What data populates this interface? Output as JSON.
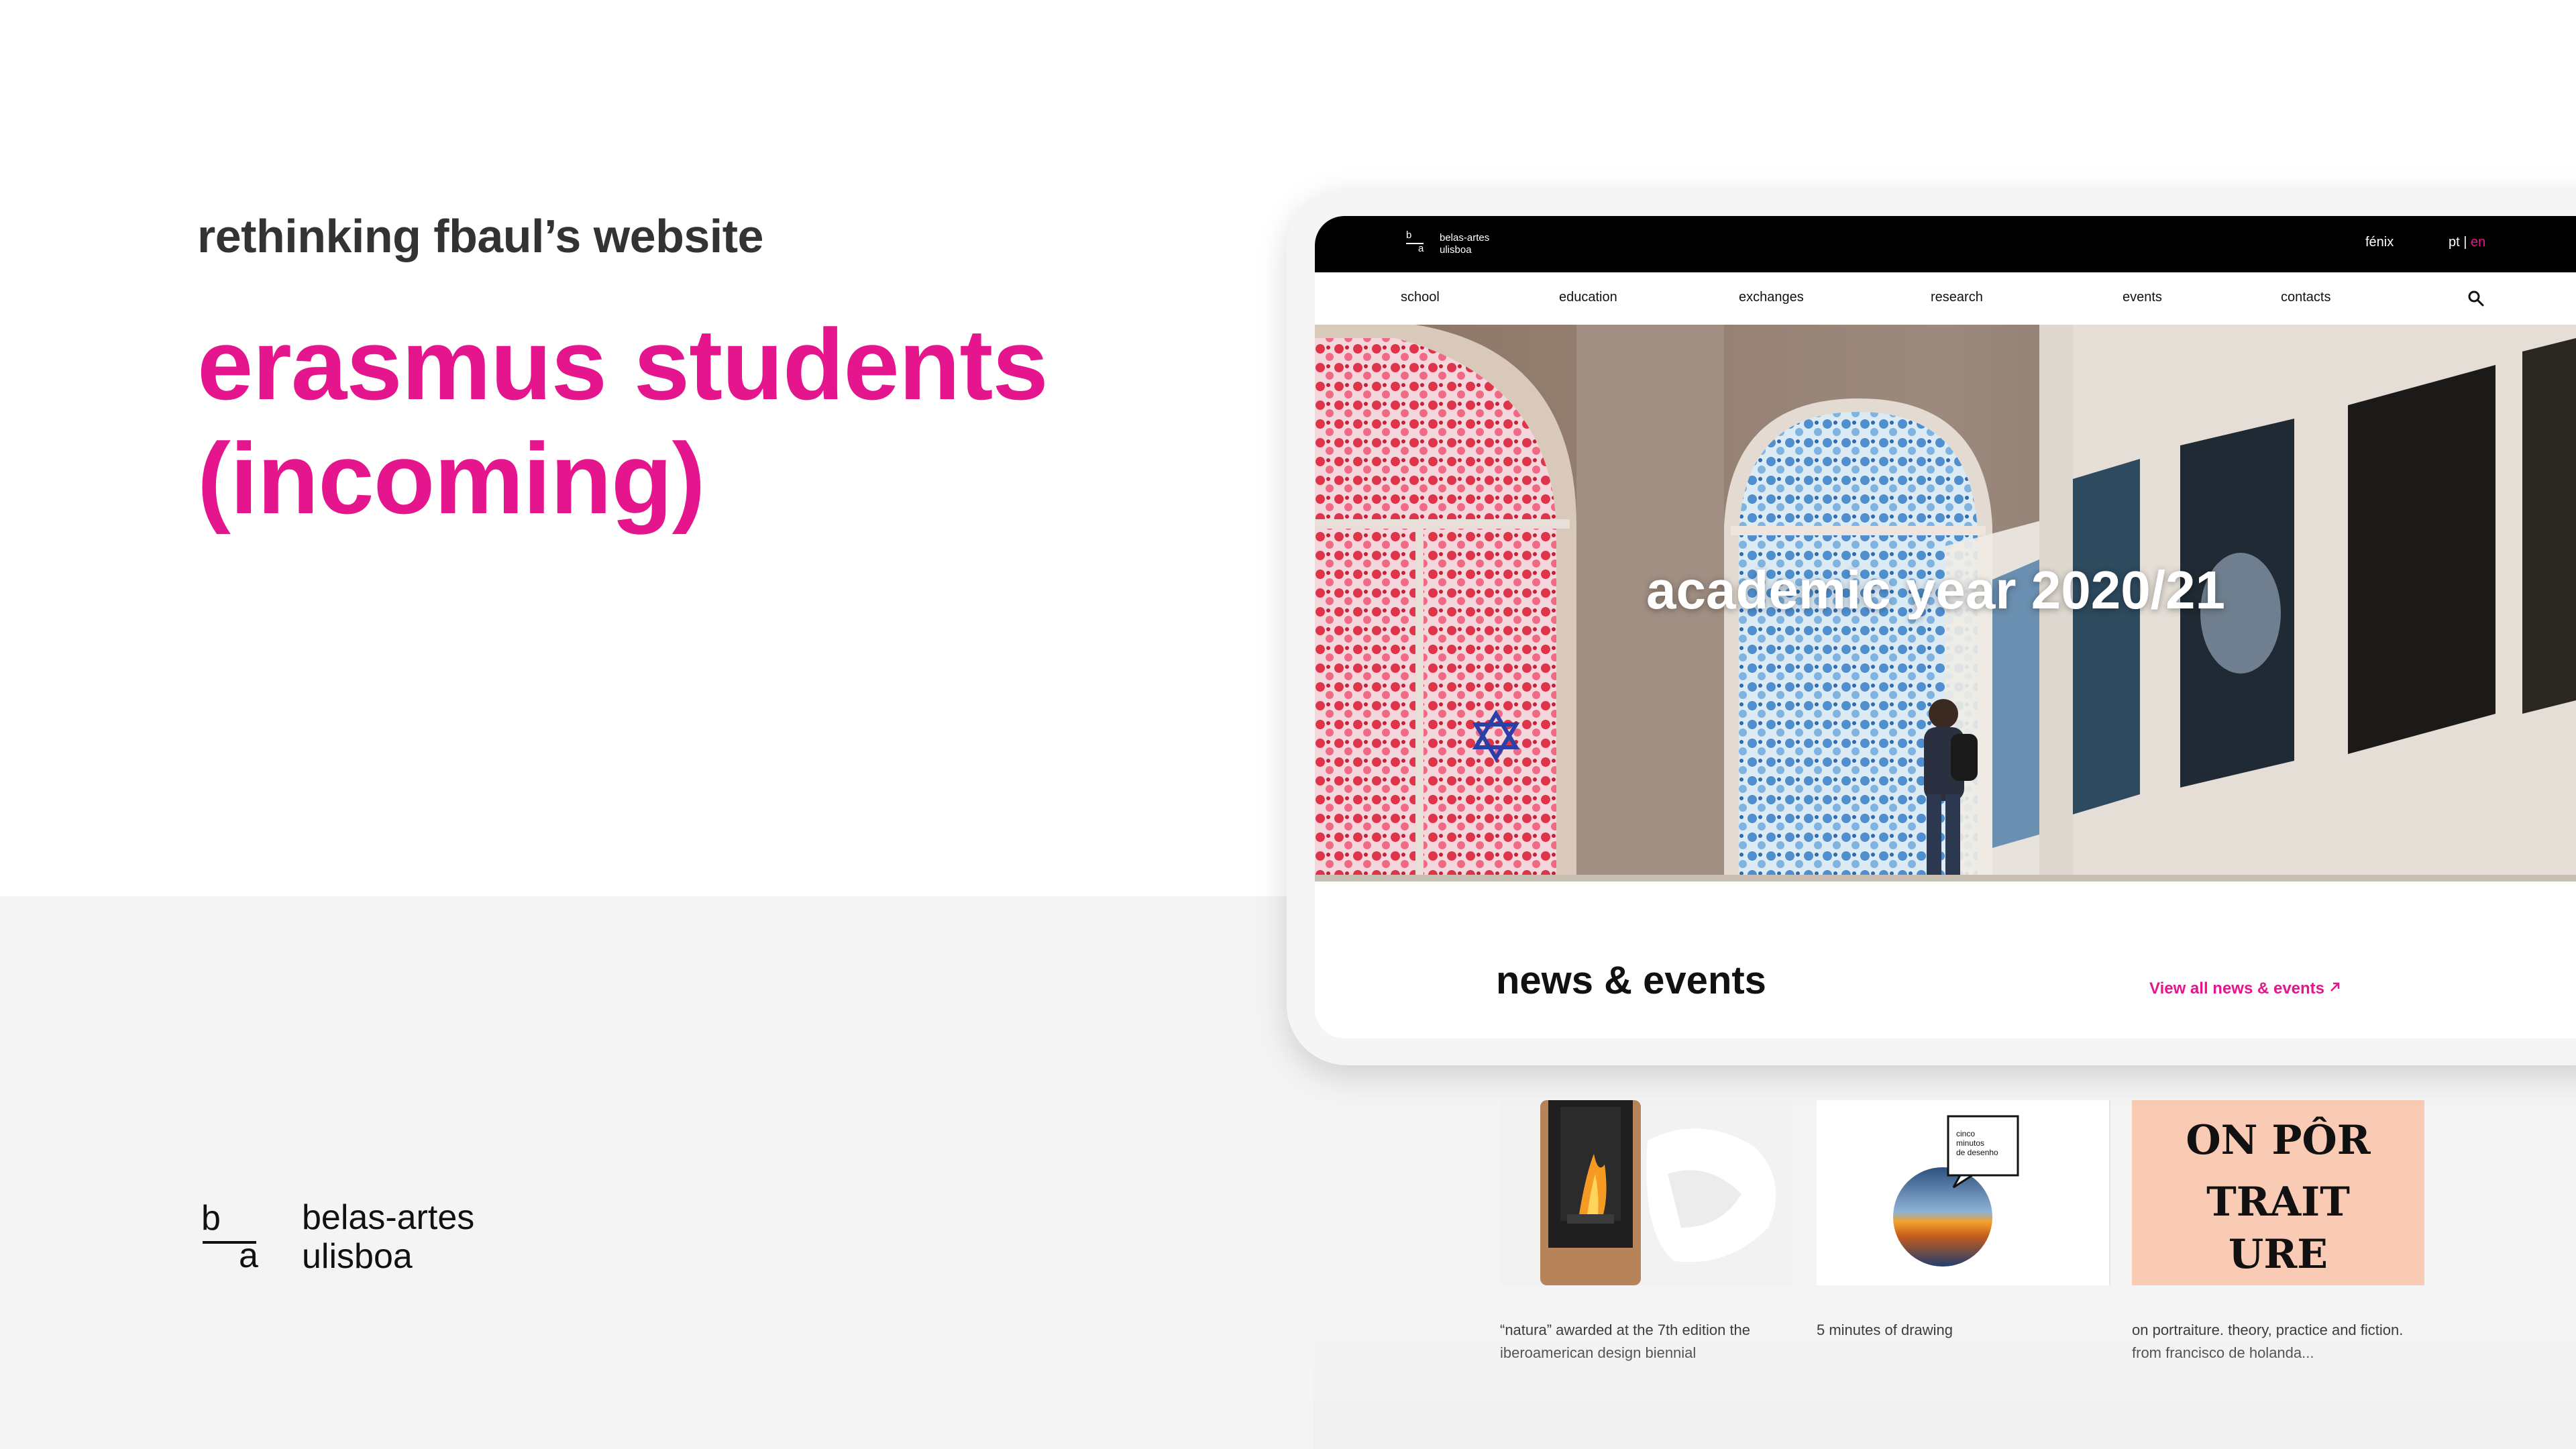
{
  "slide": {
    "kicker": "rethinking fbaul’s website",
    "headline_line1": "erasmus students",
    "headline_line2": "(incoming)",
    "brand": {
      "mark_top": "b",
      "mark_bottom": "a",
      "name_line1": "belas-artes",
      "name_line2": "ulisboa"
    }
  },
  "site": {
    "topbar": {
      "logo": {
        "mark_top": "b",
        "mark_bottom": "a",
        "name_line1": "belas-artes",
        "name_line2": "ulisboa"
      },
      "fenix": "fénix",
      "lang_pt": "pt",
      "lang_sep": "|",
      "lang_en": "en"
    },
    "nav": [
      {
        "label": "school"
      },
      {
        "label": "education"
      },
      {
        "label": "exchanges"
      },
      {
        "label": "research"
      },
      {
        "label": "events"
      },
      {
        "label": "contacts"
      }
    ],
    "search_icon": "search-icon",
    "hero": {
      "title": "academic year 2020/21"
    },
    "news": {
      "title": "news & events",
      "view_all": "View all news & events",
      "view_all_icon": "arrow-up-right-icon"
    },
    "cards": [
      {
        "caption_line1": "“natura” awarded at the 7th edition the",
        "caption_line2": "iberoamerican design biennial"
      },
      {
        "caption_line1": "5 minutes of drawing",
        "caption_line2": "",
        "poster_line1": "cinco",
        "poster_line2": "minutos",
        "poster_line3": "de desenho"
      },
      {
        "caption_line1": "on portraiture. theory, practice and fiction.",
        "caption_line2": "from francisco de holanda...",
        "poster_line1": "ON PÔR",
        "poster_line2": "TRAIT",
        "poster_line3": "URE"
      }
    ]
  },
  "colors": {
    "accent": "#e5158d",
    "text_dark": "#333333",
    "band_grey": "#f4f4f4"
  }
}
